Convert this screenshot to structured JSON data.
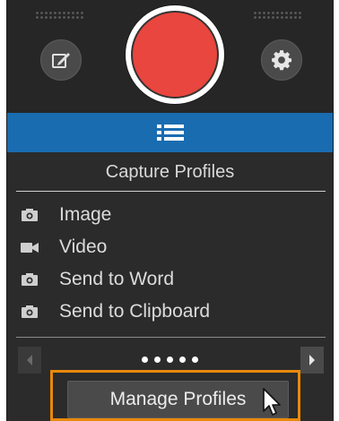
{
  "header": {
    "edit_button_icon": "edit-icon",
    "record_button_icon": "record-icon",
    "settings_button_icon": "gear-icon",
    "record_color": "#e8463e"
  },
  "toolbar": {
    "menu_icon": "list-icon",
    "accent_color": "#1a6cb0"
  },
  "section": {
    "title": "Capture Profiles"
  },
  "profiles": [
    {
      "label": "Image",
      "icon": "camera-icon"
    },
    {
      "label": "Video",
      "icon": "video-camera-icon"
    },
    {
      "label": "Send to Word",
      "icon": "camera-icon"
    },
    {
      "label": "Send to Clipboard",
      "icon": "camera-icon"
    }
  ],
  "pager": {
    "page_count": 5,
    "prev_icon": "chevron-left-icon",
    "next_icon": "chevron-right-icon"
  },
  "footer": {
    "manage_label": "Manage Profiles",
    "highlight_color": "#e8890b"
  }
}
